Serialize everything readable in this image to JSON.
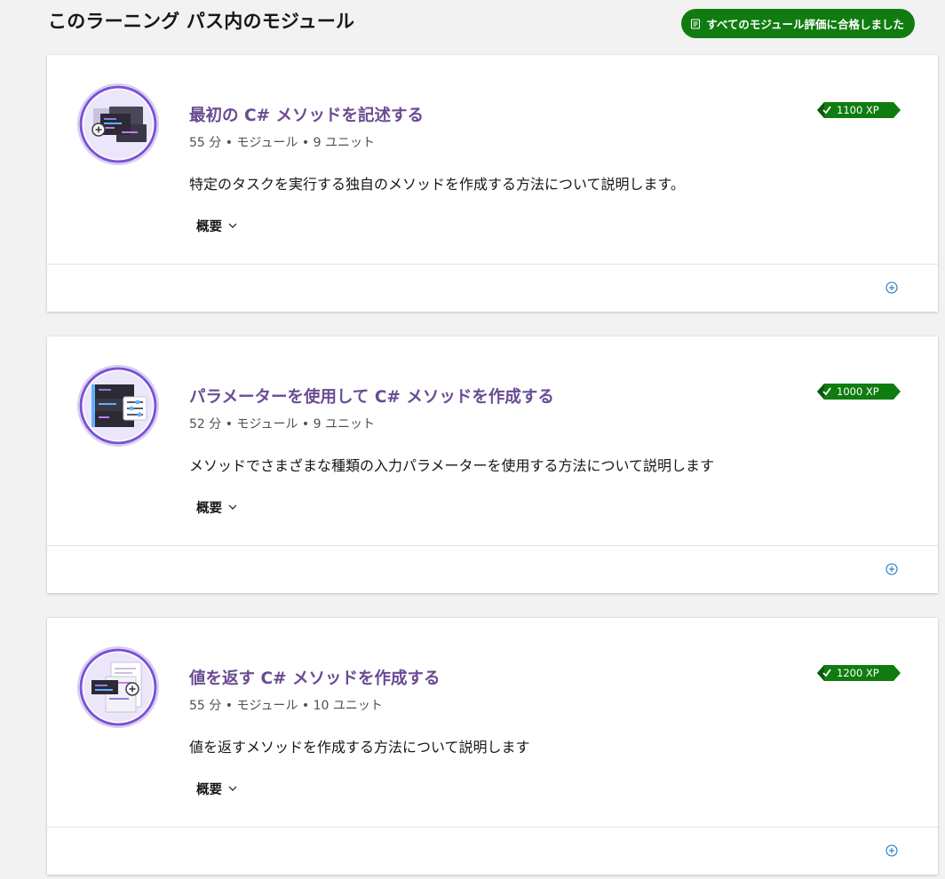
{
  "header": {
    "title": "このラーニング パス内のモジュール",
    "passed_badge_label": "すべてのモジュール評価に合格しました"
  },
  "colors": {
    "accent_title": "#6a4c93",
    "success_green": "#107c10",
    "expand_icon_blue": "#0f6cbd"
  },
  "modules": [
    {
      "title": "最初の C# メソッドを記述する",
      "meta": "55 分 • モジュール • 9 ユニット",
      "description": "特定のタスクを実行する独自のメソッドを作成する方法について説明します。",
      "xp": "1100 XP",
      "overview_label": "概要",
      "icon": "code-window-add-icon"
    },
    {
      "title": "パラメーターを使用して C# メソッドを作成する",
      "meta": "52 分 • モジュール • 9 ユニット",
      "description": "メソッドでさまざまな種類の入力パラメーターを使用する方法について説明します",
      "xp": "1000 XP",
      "overview_label": "概要",
      "icon": "code-window-sliders-icon"
    },
    {
      "title": "値を返す C# メソッドを作成する",
      "meta": "55 分 • モジュール • 10 ユニット",
      "description": "値を返すメソッドを作成する方法について説明します",
      "xp": "1200 XP",
      "overview_label": "概要",
      "icon": "code-document-add-icon"
    }
  ]
}
